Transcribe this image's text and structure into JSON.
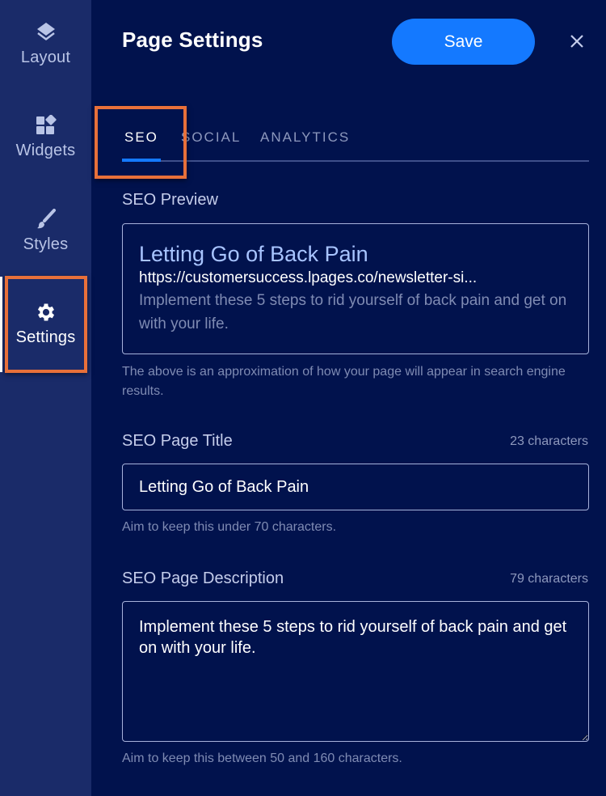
{
  "sidebar": {
    "items": [
      {
        "label": "Layout",
        "icon": "layers-icon"
      },
      {
        "label": "Widgets",
        "icon": "widgets-icon"
      },
      {
        "label": "Styles",
        "icon": "brush-icon"
      },
      {
        "label": "Settings",
        "icon": "gear-icon",
        "active": true
      }
    ]
  },
  "header": {
    "title": "Page Settings",
    "save_label": "Save",
    "close_icon": "close-icon"
  },
  "tabs": [
    {
      "label": "SEO",
      "active": true
    },
    {
      "label": "SOCIAL",
      "active": false
    },
    {
      "label": "ANALYTICS",
      "active": false
    }
  ],
  "seo_preview": {
    "label": "SEO Preview",
    "title": "Letting Go of Back Pain",
    "url": "https://customersuccess.lpages.co/newsletter-si...",
    "description": "Implement these 5 steps to rid yourself of back pain and get on with your life.",
    "helper": "The above is an approximation of how your page will appear in search engine results."
  },
  "seo_title": {
    "label": "SEO Page Title",
    "count": "23 characters",
    "value": "Letting Go of Back Pain",
    "helper": "Aim to keep this under 70 characters."
  },
  "seo_description": {
    "label": "SEO Page Description",
    "count": "79 characters",
    "value": "Implement these 5 steps to rid yourself of back pain and get on with your life.",
    "helper": "Aim to keep this between 50 and 160 characters."
  },
  "colors": {
    "background": "#01124d",
    "sidebar": "#1a2b69",
    "accent": "#1479ff",
    "highlight": "#e8703a"
  }
}
